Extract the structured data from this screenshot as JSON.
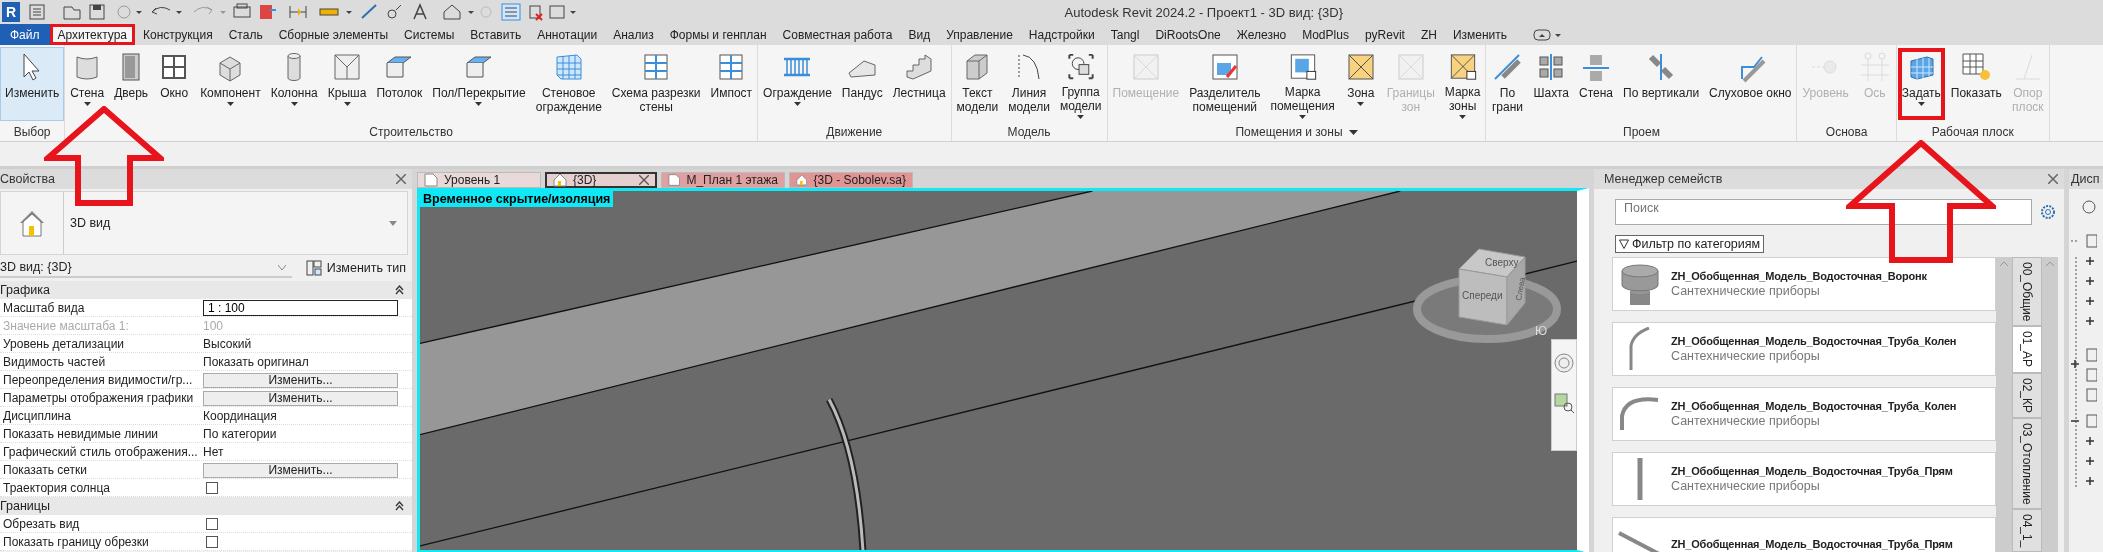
{
  "title_bar": {
    "logo": "R",
    "title": "Autodesk Revit 2024.2 - Проект1 - 3D вид: {3D}"
  },
  "menu_tabs": [
    {
      "label": "Файл",
      "kind": "file",
      "selected": false
    },
    {
      "label": "Архитектура",
      "kind": "tab",
      "selected": true
    },
    {
      "label": "Конструкция",
      "kind": "tab",
      "selected": false
    },
    {
      "label": "Сталь",
      "kind": "tab",
      "selected": false
    },
    {
      "label": "Сборные элементы",
      "kind": "tab",
      "selected": false
    },
    {
      "label": "Системы",
      "kind": "tab",
      "selected": false
    },
    {
      "label": "Вставить",
      "kind": "tab",
      "selected": false
    },
    {
      "label": "Аннотации",
      "kind": "tab",
      "selected": false
    },
    {
      "label": "Анализ",
      "kind": "tab",
      "selected": false
    },
    {
      "label": "Формы и генплан",
      "kind": "tab",
      "selected": false
    },
    {
      "label": "Совместная работа",
      "kind": "tab",
      "selected": false
    },
    {
      "label": "Вид",
      "kind": "tab",
      "selected": false
    },
    {
      "label": "Управление",
      "kind": "tab",
      "selected": false
    },
    {
      "label": "Надстройки",
      "kind": "tab",
      "selected": false
    },
    {
      "label": "Tangl",
      "kind": "tab",
      "selected": false
    },
    {
      "label": "DiRootsOne",
      "kind": "tab",
      "selected": false
    },
    {
      "label": "Железно",
      "kind": "tab",
      "selected": false
    },
    {
      "label": "ModPlus",
      "kind": "tab",
      "selected": false
    },
    {
      "label": "pyRevit",
      "kind": "tab",
      "selected": false
    },
    {
      "label": "ZH",
      "kind": "tab",
      "selected": false
    },
    {
      "label": "Изменить",
      "kind": "tab",
      "selected": false
    }
  ],
  "ribbon_groups": [
    {
      "title": "Выбор",
      "dropdown": false,
      "buttons": [
        {
          "lines": [
            "Изменить"
          ],
          "dropdown": false,
          "disabled": false,
          "active": true
        }
      ]
    },
    {
      "title": "Строительство",
      "dropdown": false,
      "buttons": [
        {
          "lines": [
            "Стена"
          ],
          "dropdown": true,
          "disabled": false,
          "active": false
        },
        {
          "lines": [
            "Дверь"
          ],
          "dropdown": false,
          "disabled": false,
          "active": false
        },
        {
          "lines": [
            "Окно"
          ],
          "dropdown": false,
          "disabled": false,
          "active": false
        },
        {
          "lines": [
            "Компонент"
          ],
          "dropdown": true,
          "disabled": false,
          "active": false
        },
        {
          "lines": [
            "Колонна"
          ],
          "dropdown": true,
          "disabled": false,
          "active": false
        },
        {
          "lines": [
            "Крыша"
          ],
          "dropdown": true,
          "disabled": false,
          "active": false
        },
        {
          "lines": [
            "Потолок"
          ],
          "dropdown": false,
          "disabled": false,
          "active": false
        },
        {
          "lines": [
            "Пол/Перекрытие"
          ],
          "dropdown": true,
          "disabled": false,
          "active": false
        },
        {
          "lines": [
            "Стеновое",
            "ограждение"
          ],
          "dropdown": false,
          "disabled": false,
          "active": false
        },
        {
          "lines": [
            "Схема разрезки",
            "стены"
          ],
          "dropdown": false,
          "disabled": false,
          "active": false
        },
        {
          "lines": [
            "Импост"
          ],
          "dropdown": false,
          "disabled": false,
          "active": false
        }
      ]
    },
    {
      "title": "Движение",
      "dropdown": false,
      "buttons": [
        {
          "lines": [
            "Ограждение"
          ],
          "dropdown": true,
          "disabled": false,
          "active": false
        },
        {
          "lines": [
            "Пандус"
          ],
          "dropdown": false,
          "disabled": false,
          "active": false
        },
        {
          "lines": [
            "Лестница"
          ],
          "dropdown": false,
          "disabled": false,
          "active": false
        }
      ]
    },
    {
      "title": "Модель",
      "dropdown": false,
      "buttons": [
        {
          "lines": [
            "Текст",
            "модели"
          ],
          "dropdown": false,
          "disabled": false,
          "active": false
        },
        {
          "lines": [
            "Линия",
            "модели"
          ],
          "dropdown": false,
          "disabled": false,
          "active": false
        },
        {
          "lines": [
            "Группа",
            "модели"
          ],
          "dropdown": true,
          "disabled": false,
          "active": false
        }
      ]
    },
    {
      "title": "Помещения и зоны",
      "dropdown": true,
      "buttons": [
        {
          "lines": [
            "Помещение"
          ],
          "dropdown": false,
          "disabled": true,
          "active": false
        },
        {
          "lines": [
            "Разделитель",
            "помещений"
          ],
          "dropdown": false,
          "disabled": false,
          "active": false
        },
        {
          "lines": [
            "Марка",
            "помещения"
          ],
          "dropdown": true,
          "disabled": false,
          "active": false
        },
        {
          "lines": [
            "Зона"
          ],
          "dropdown": true,
          "disabled": false,
          "active": false
        },
        {
          "lines": [
            "Границы",
            "зон"
          ],
          "dropdown": false,
          "disabled": true,
          "active": false
        },
        {
          "lines": [
            "Марка",
            "зоны"
          ],
          "dropdown": true,
          "disabled": false,
          "active": false
        }
      ]
    },
    {
      "title": "Проем",
      "dropdown": false,
      "buttons": [
        {
          "lines": [
            "По",
            "грани"
          ],
          "dropdown": false,
          "disabled": false,
          "active": false
        },
        {
          "lines": [
            "Шахта"
          ],
          "dropdown": false,
          "disabled": false,
          "active": false
        },
        {
          "lines": [
            "Стена"
          ],
          "dropdown": false,
          "disabled": false,
          "active": false
        },
        {
          "lines": [
            "По вертикали"
          ],
          "dropdown": false,
          "disabled": false,
          "active": false
        },
        {
          "lines": [
            "Слуховое окно"
          ],
          "dropdown": false,
          "disabled": false,
          "active": false
        }
      ]
    },
    {
      "title": "Основа",
      "dropdown": false,
      "buttons": [
        {
          "lines": [
            "Уровень"
          ],
          "dropdown": false,
          "disabled": true,
          "active": false
        },
        {
          "lines": [
            "Ось"
          ],
          "dropdown": false,
          "disabled": true,
          "active": false
        }
      ]
    },
    {
      "title": "Рабочая плоск",
      "dropdown": false,
      "buttons": [
        {
          "lines": [
            "Задать"
          ],
          "dropdown": true,
          "disabled": false,
          "active": false
        },
        {
          "lines": [
            "Показать"
          ],
          "dropdown": false,
          "disabled": false,
          "active": false
        },
        {
          "lines": [
            "Опор",
            "плоск"
          ],
          "dropdown": false,
          "disabled": true,
          "active": false
        }
      ]
    }
  ],
  "properties": {
    "title": "Свойства",
    "type_name": "3D вид",
    "instance_selector": "3D вид: {3D}",
    "edit_type": "Изменить тип",
    "sections": [
      {
        "title": "Графика",
        "expanded": true,
        "rows": [
          {
            "name": "Масштаб вида",
            "kind": "input",
            "value": "1 : 100",
            "disabled": false
          },
          {
            "name": "Значение масштаба    1:",
            "kind": "text",
            "value": "100",
            "disabled": true
          },
          {
            "name": "Уровень детализации",
            "kind": "text",
            "value": "Высокий",
            "disabled": false
          },
          {
            "name": "Видимость частей",
            "kind": "text",
            "value": "Показать оригинал",
            "disabled": false
          },
          {
            "name": "Переопределения видимости/гр...",
            "kind": "button",
            "value": "Изменить...",
            "disabled": false
          },
          {
            "name": "Параметры отображения графики",
            "kind": "button",
            "value": "Изменить...",
            "disabled": false
          },
          {
            "name": "Дисциплина",
            "kind": "text",
            "value": "Координация",
            "disabled": false
          },
          {
            "name": "Показать невидимые линии",
            "kind": "text",
            "value": "По категории",
            "disabled": false
          },
          {
            "name": "Графический стиль отображения...",
            "kind": "text",
            "value": "Нет",
            "disabled": false
          },
          {
            "name": "Показать сетки",
            "kind": "button",
            "value": "Изменить...",
            "disabled": false
          },
          {
            "name": "Траектория солнца",
            "kind": "checkbox",
            "checked": false,
            "disabled": false
          }
        ]
      },
      {
        "title": "Границы",
        "expanded": true,
        "rows": [
          {
            "name": "Обрезать вид",
            "kind": "checkbox",
            "checked": false,
            "disabled": false
          },
          {
            "name": "Показать границу обрезки",
            "kind": "checkbox",
            "checked": false,
            "disabled": false
          }
        ]
      }
    ]
  },
  "view_tabs": [
    {
      "label": "Уровень 1",
      "kind": "plan",
      "selected": false,
      "color": "#ead9d9"
    },
    {
      "label": "{3D}",
      "kind": "perspective",
      "selected": true,
      "color": "#e6cfcf"
    },
    {
      "label": "М_План 1 этажа",
      "kind": "plan",
      "selected": false,
      "color": "#e0a0a0"
    },
    {
      "label": "{3D - Sobolev.sa}",
      "kind": "perspective",
      "selected": false,
      "color": "#e09494"
    }
  ],
  "viewport": {
    "badge": "Временное скрытие/изоляция",
    "view_cube": {
      "top": "Сверху",
      "left": "Слева",
      "front": "Спереди",
      "south": "Ю"
    }
  },
  "family_manager": {
    "title": "Менеджер семейств",
    "search_placeholder": "Поиск",
    "filter": "Фильтр по категориям",
    "items": [
      {
        "name": "ZH_Обобщенная_Модель_Водосточная_Воронк",
        "category": "Сантехнические приборы",
        "kind": "funnel"
      },
      {
        "name": "ZH_Обобщенная_Модель_Водосточная_Труба_Колен",
        "category": "Сантехнические приборы",
        "kind": "bend"
      },
      {
        "name": "ZH_Обобщенная_Модель_Водосточная_Труба_Колен",
        "category": "Сантехнические приборы",
        "kind": "arc"
      },
      {
        "name": "ZH_Обобщенная_Модель_Водосточная_Труба_Прям",
        "category": "Сантехнические приборы",
        "kind": "straight"
      },
      {
        "name": "ZH_Обобщенная_Модель_Водосточная_Труба_Прям",
        "kind": "diagonal"
      }
    ],
    "tabs": [
      {
        "label": "00_Общие",
        "selected": false
      },
      {
        "label": "01_АР",
        "selected": true
      },
      {
        "label": "02_КР",
        "selected": false
      },
      {
        "label": "03_Отопление",
        "selected": false
      },
      {
        "label": "04_1_",
        "selected": false
      }
    ]
  },
  "dispatcher": {
    "title": "Дисп"
  }
}
